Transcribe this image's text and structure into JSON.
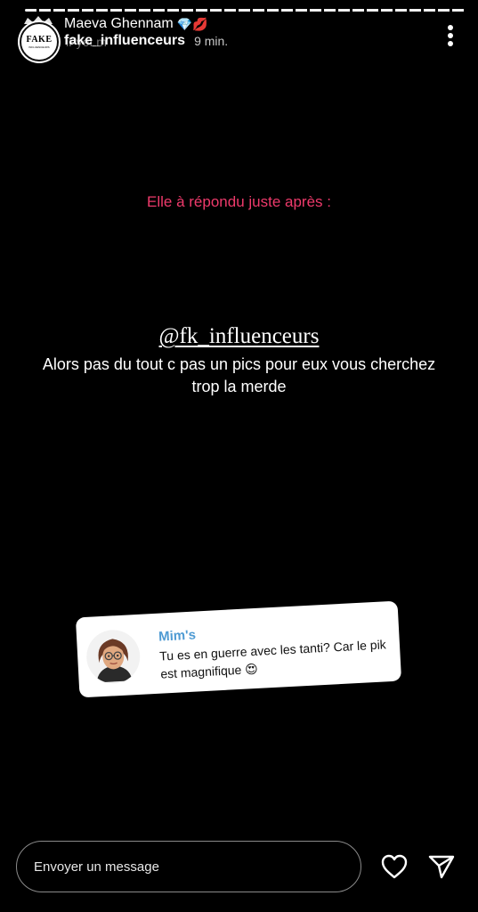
{
  "header": {
    "display_name": "Maeva Ghennam",
    "display_name_emojis": "💎💋",
    "username": "fake_influenceurs",
    "timestamp": "9 min.",
    "ghost_text": "iFyeLm",
    "avatar_text": "FAKE",
    "avatar_subtext": "INFLUENCEURS"
  },
  "story": {
    "caption": "Elle à répondu juste après :",
    "mention": "@fk_influenceurs",
    "message": "Alors pas du tout c pas un pics pour eux vous cherchez trop la merde"
  },
  "reply_card": {
    "author": "Mim's",
    "text": "Tu es en guerre avec les tanti? Car le pik est magnifique 😍"
  },
  "footer": {
    "placeholder": "Envoyer un message"
  },
  "colors": {
    "caption": "#ee3a6b",
    "card_author": "#4f9bd3",
    "background": "#000000"
  },
  "icons": {
    "menu": "three-dots-vertical",
    "like": "heart-outline",
    "send": "paper-plane"
  }
}
